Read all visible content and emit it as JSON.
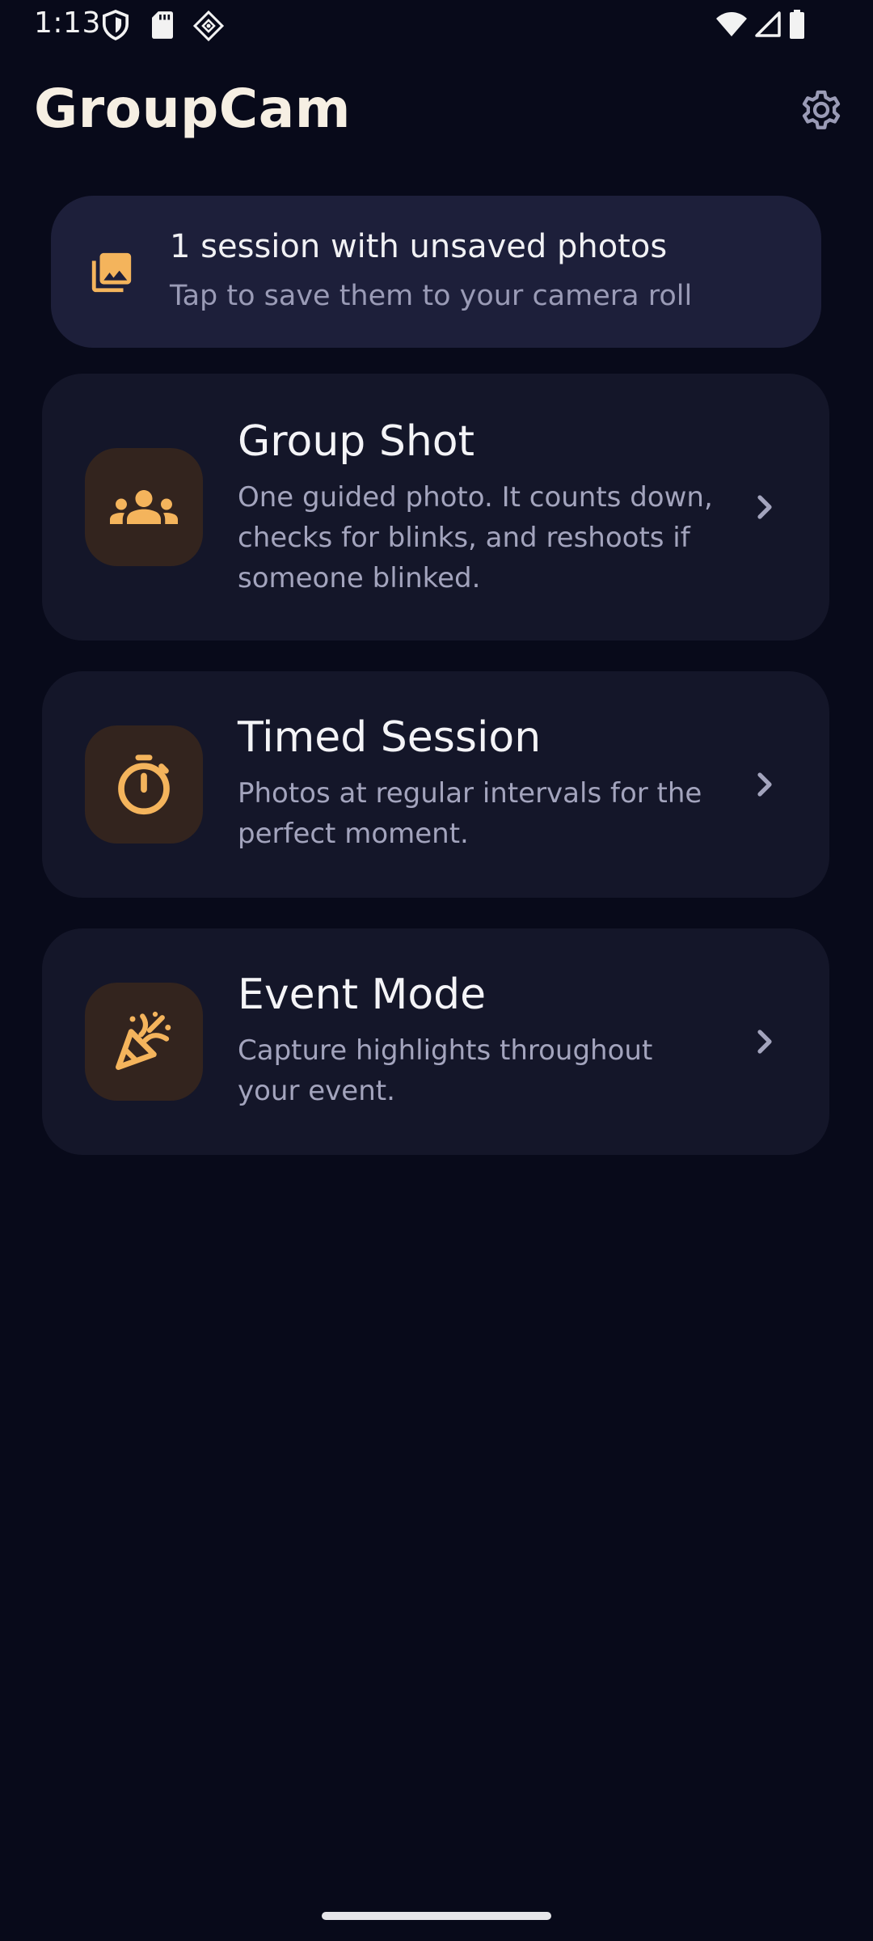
{
  "status_bar": {
    "time": "1:13"
  },
  "header": {
    "title": "GroupCam"
  },
  "banner": {
    "title": "1 session with unsaved photos",
    "subtitle": "Tap to save them to your camera roll"
  },
  "modes": [
    {
      "title": "Group Shot",
      "description": "One guided photo. It counts down, checks for blinks, and reshoots if someone blinked.",
      "icon": "group-icon"
    },
    {
      "title": "Timed Session",
      "description": "Photos at regular intervals for the perfect moment.",
      "icon": "timer-icon"
    },
    {
      "title": "Event Mode",
      "description": "Capture highlights throughout your event.",
      "icon": "party-popper-icon"
    }
  ],
  "colors": {
    "background": "#080a1a",
    "card": "#141629",
    "banner": "#1d1f3a",
    "accent": "#f4b45c",
    "icon_tile": "#33241e"
  }
}
